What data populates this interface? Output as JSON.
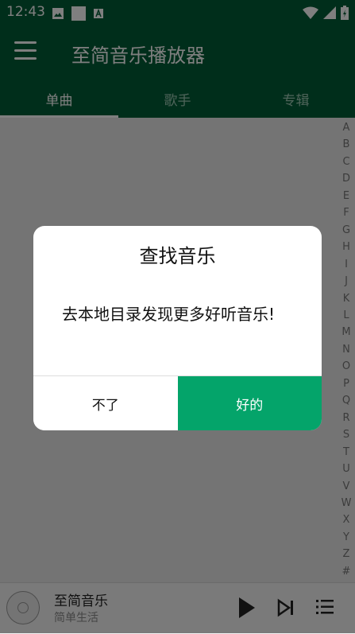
{
  "status_bar": {
    "time": "12:43"
  },
  "app_bar": {
    "title": "至简音乐播放器"
  },
  "tabs": [
    {
      "label": "单曲",
      "active": true
    },
    {
      "label": "歌手",
      "active": false
    },
    {
      "label": "专辑",
      "active": false
    }
  ],
  "alphabet_index": [
    "A",
    "B",
    "C",
    "D",
    "E",
    "F",
    "G",
    "H",
    "I",
    "J",
    "K",
    "L",
    "M",
    "N",
    "O",
    "P",
    "Q",
    "R",
    "S",
    "T",
    "U",
    "V",
    "W",
    "X",
    "Y",
    "Z",
    "#"
  ],
  "player": {
    "title": "至简音乐",
    "subtitle": "简单生活"
  },
  "dialog": {
    "title": "查找音乐",
    "message": "去本地目录发现更多好听音乐!",
    "cancel_label": "不了",
    "ok_label": "好的"
  },
  "colors": {
    "primary": "#005c37",
    "accent": "#04a46a"
  }
}
